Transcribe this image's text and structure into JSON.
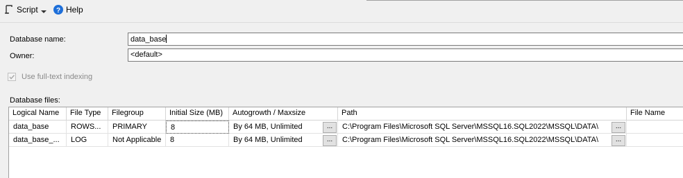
{
  "toolbar": {
    "script_label": "Script",
    "help_label": "Help",
    "script_icon": "script-icon",
    "dropdown_icon": "chevron-down-icon",
    "help_icon": "help-icon"
  },
  "form": {
    "database_name_label": "Database name:",
    "database_name_value": "data_base",
    "owner_label": "Owner:",
    "owner_value": "<default>",
    "fulltext_label": "Use full-text indexing",
    "fulltext_checked": true,
    "fulltext_disabled": true,
    "files_label": "Database files:"
  },
  "grid": {
    "columns": [
      "Logical Name",
      "File Type",
      "Filegroup",
      "Initial Size (MB)",
      "Autogrowth / Maxsize",
      "Path",
      "File Name"
    ],
    "rows": [
      {
        "logical_name": "data_base",
        "file_type": "ROWS...",
        "filegroup": "PRIMARY",
        "initial_size": "8",
        "autogrowth": "By 64 MB, Unlimited",
        "path": "C:\\Program Files\\Microsoft SQL Server\\MSSQL16.SQL2022\\MSSQL\\DATA\\",
        "file_name": ""
      },
      {
        "logical_name": "data_base_...",
        "file_type": "LOG",
        "filegroup": "Not Applicable",
        "initial_size": "8",
        "autogrowth": "By 64 MB, Unlimited",
        "path": "C:\\Program Files\\Microsoft SQL Server\\MSSQL16.SQL2022\\MSSQL\\DATA\\",
        "file_name": ""
      }
    ],
    "ellipsis": "..."
  },
  "colors": {
    "help_blue": "#1e6fd9",
    "window_bg": "#f0f0f0"
  }
}
